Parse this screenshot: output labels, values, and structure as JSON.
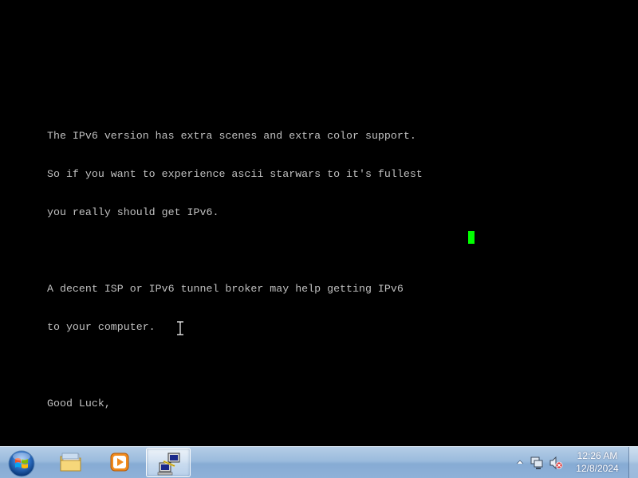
{
  "terminal": {
    "lines": [
      "The IPv6 version has extra scenes and extra color support.",
      "So if you want to experience ascii starwars to it's fullest",
      "you really should get IPv6.",
      "",
      "A decent ISP or IPv6 tunnel broker may help getting IPv6",
      "to your computer.",
      "",
      "Good Luck,"
    ],
    "text_color": "#c0c0c0",
    "cursor_color": "#00ff00",
    "background_color": "#000000"
  },
  "taskbar": {
    "start_icon": "windows-logo-icon",
    "pinned": [
      {
        "name": "windows-explorer",
        "icon": "folder-icon",
        "active": false
      },
      {
        "name": "media-player",
        "icon": "media-player-icon",
        "active": false
      },
      {
        "name": "putty",
        "icon": "putty-icon",
        "active": true
      }
    ],
    "tray": {
      "icons": [
        "show-hidden-icons-chevron-icon",
        "network-icon",
        "volume-muted-icon"
      ],
      "time": "12:26 AM",
      "date": "12/8/2024"
    }
  }
}
